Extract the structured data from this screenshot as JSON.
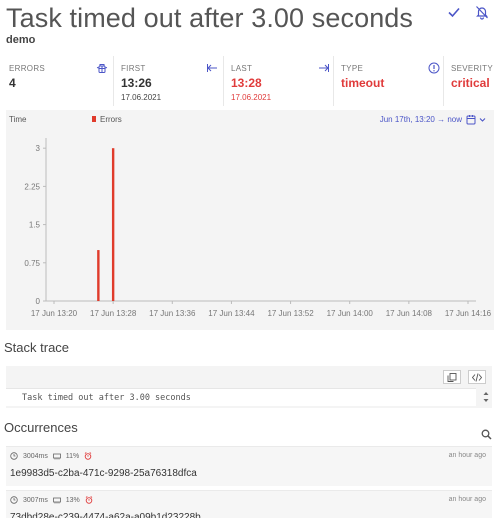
{
  "header": {
    "title": "Task timed out after 3.00 seconds",
    "subtitle": "demo",
    "check_icon": "check-icon",
    "mute_icon": "bell-off-icon"
  },
  "stats": {
    "errors": {
      "label": "ERRORS",
      "value": "4",
      "icon": "bug-icon"
    },
    "first": {
      "label": "FIRST",
      "time": "13:26",
      "date": "17.06.2021",
      "icon": "arrow-to-left-icon"
    },
    "last": {
      "label": "LAST",
      "time": "13:28",
      "date": "17.06.2021",
      "icon": "arrow-to-right-icon"
    },
    "type": {
      "label": "TYPE",
      "value": "timeout",
      "icon": "info-icon"
    },
    "severity": {
      "label": "SEVERITY",
      "value": "critical"
    }
  },
  "chart": {
    "time_label": "Time",
    "legend_label": "Errors",
    "range_label": "Jun 17th, 13:20 → now",
    "calendar_icon": "calendar-icon",
    "dropdown_icon": "chevron-down-icon"
  },
  "chart_data": {
    "type": "bar",
    "series": [
      {
        "name": "Errors",
        "color": "#e03b2b",
        "points": [
          {
            "x": "17 Jun 13:26",
            "y": 1
          },
          {
            "x": "17 Jun 13:28",
            "y": 3
          }
        ]
      }
    ],
    "x_ticks": [
      "17 Jun 13:20",
      "17 Jun 13:28",
      "17 Jun 13:36",
      "17 Jun 13:44",
      "17 Jun 13:52",
      "17 Jun 14:00",
      "17 Jun 14:08",
      "17 Jun 14:16"
    ],
    "y_ticks": [
      "0",
      "0.75",
      "1.5",
      "2.25",
      "3"
    ],
    "ylim": [
      0,
      3.2
    ],
    "grid": false
  },
  "stack": {
    "title": "Stack trace",
    "code": "Task timed out after 3.00 seconds",
    "copy_icon": "copy-icon",
    "code_icon": "code-icon"
  },
  "occurrences": {
    "title": "Occurrences",
    "search_icon": "search-icon",
    "items": [
      {
        "duration": "3004ms",
        "memory": "11%",
        "id": "1e9983d5-c2ba-471c-9298-25a76318dfca",
        "time": "an hour ago"
      },
      {
        "duration": "3007ms",
        "memory": "13%",
        "id": "73dbd28e-c239-4474-a62a-a09b1d23228b",
        "time": "an hour ago"
      }
    ]
  },
  "colors": {
    "accent": "#4b55c7",
    "error": "#e03b3b",
    "bar": "#e03b2b"
  }
}
